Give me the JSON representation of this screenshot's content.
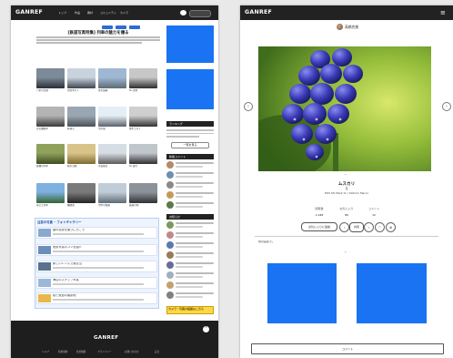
{
  "colors": {
    "header": "#222222",
    "accent_blue": "#1a73f2",
    "footer": "#1e1e1e",
    "tab_blue": "#2d6bd6",
    "cta_yellow": "#ffd84a"
  },
  "left": {
    "logo": "GANREF",
    "nav": [
      "トップ",
      "作品",
      "機材",
      "コミュニティ",
      "カメラ"
    ],
    "headline": "[鉄道写真特集] 列車の魅力を撮る",
    "tabs": [
      "作品",
      "機材",
      "特集"
    ],
    "gallery_captions": [
      "汽車の出発",
      "雪原を行く",
      "冬の鉄路",
      "SL 黒煙",
      "蒸気機関車",
      "峠越え",
      "雪の駅",
      "煙を上げて",
      "鉄橋の列車",
      "秋の沿線",
      "木造駅舎",
      "SL 運行",
      "青空と列車",
      "機関庫",
      "雪中の旅路",
      "鉄路の朝"
    ],
    "more_button": "もっと見る",
    "feature_box_title": "注目の写真 ─ フォトギャラリー",
    "feature_items": [
      "春の風景を撮りに行こう",
      "夜景写真のコツを紹介",
      "新しいレンズで撮る山",
      "海辺のスナップ写真",
      "桜と鉄道の撮影地"
    ],
    "sidebar_sections": [
      "ランキング",
      "新着コメント",
      "お知らせ"
    ],
    "sidebar_button": "一覧を見る",
    "sidebar_cta": "カメラ・写真の相談はこちら",
    "footer_logo": "GANREF",
    "footer_links": [
      "ヘルプ",
      "利用規約",
      "会社概要",
      "プライバシー",
      "お問い合わせ",
      "広告"
    ]
  },
  "right": {
    "logo": "GANREF",
    "author": "高橋克美",
    "photo_title": "ムスカリ",
    "photo_sub": "花",
    "camera_line": "EOS 5D Mark IV / 100mm Macro",
    "stats": [
      "閲覧数",
      "お気に入り",
      "コメント"
    ],
    "stat_values": [
      "1,248",
      "86",
      "12"
    ],
    "action_button": "お気に入りに追加",
    "share_label": "共有",
    "caption_text": "春の庭先で。",
    "comment_button": "コメント"
  }
}
